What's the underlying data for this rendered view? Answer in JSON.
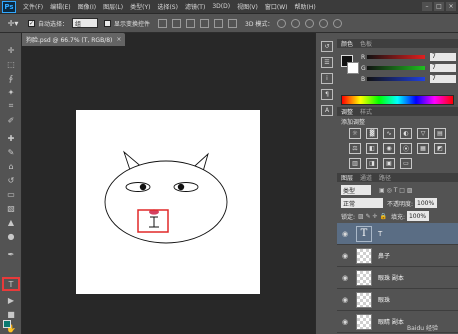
{
  "app": {
    "logo": "Ps"
  },
  "menubar": {
    "items": [
      "文件(F)",
      "编辑(E)",
      "图像(I)",
      "图层(L)",
      "类型(Y)",
      "选择(S)",
      "滤镜(T)",
      "3D(D)",
      "视图(V)",
      "窗口(W)",
      "帮助(H)"
    ],
    "window_buttons": [
      "–",
      "□",
      "×"
    ]
  },
  "options_bar": {
    "auto_select_label": "自动选择：",
    "auto_select_value": "组",
    "show_transform_label": "显示变换控件",
    "mode_3d_label": "3D 模式："
  },
  "document": {
    "tab_title": "狗脸.psd @ 66.7% (T, RGB/8)",
    "tab_close": "×",
    "canvas_bg": "#ffffff"
  },
  "panels": {
    "color": {
      "tab_active": "颜色",
      "tab_inactive": "色板",
      "rows": [
        {
          "label": "R",
          "value": "7",
          "color": "#e02020"
        },
        {
          "label": "G",
          "value": "7",
          "color": "#20c020"
        },
        {
          "label": "B",
          "value": "7",
          "color": "#2040e0"
        }
      ]
    },
    "adjustments": {
      "tab_active": "调整",
      "tab_inactive": "样式",
      "title": "添加调整"
    },
    "layers": {
      "tabs": [
        "图层",
        "通道",
        "路径"
      ],
      "kind_value": "类型",
      "blend_value": "正常",
      "opacity_label": "不透明度:",
      "opacity_value": "100%",
      "lock_label": "锁定:",
      "fill_label": "填充:",
      "fill_value": "100%",
      "items": [
        {
          "name": "T",
          "type": "text",
          "active": true
        },
        {
          "name": "鼻子",
          "type": "normal",
          "active": false
        },
        {
          "name": "眼珠 副本",
          "type": "normal",
          "active": false
        },
        {
          "name": "眼珠",
          "type": "normal",
          "active": false
        },
        {
          "name": "眼睛 副本",
          "type": "normal",
          "active": false
        }
      ],
      "watermark": "Baidu 经验"
    }
  },
  "colors": {
    "highlight_red": "#e02828",
    "nose_fill": "#d44060"
  },
  "icons": [
    "move-tool-icon",
    "marquee-tool-icon",
    "lasso-tool-icon",
    "magic-wand-icon",
    "crop-tool-icon",
    "eyedropper-icon",
    "brush-tool-icon",
    "stamp-tool-icon",
    "eraser-tool-icon",
    "gradient-tool-icon",
    "pen-tool-icon",
    "type-tool-icon",
    "path-select-icon",
    "shape-tool-icon",
    "hand-tool-icon",
    "zoom-tool-icon",
    "eye-icon"
  ]
}
